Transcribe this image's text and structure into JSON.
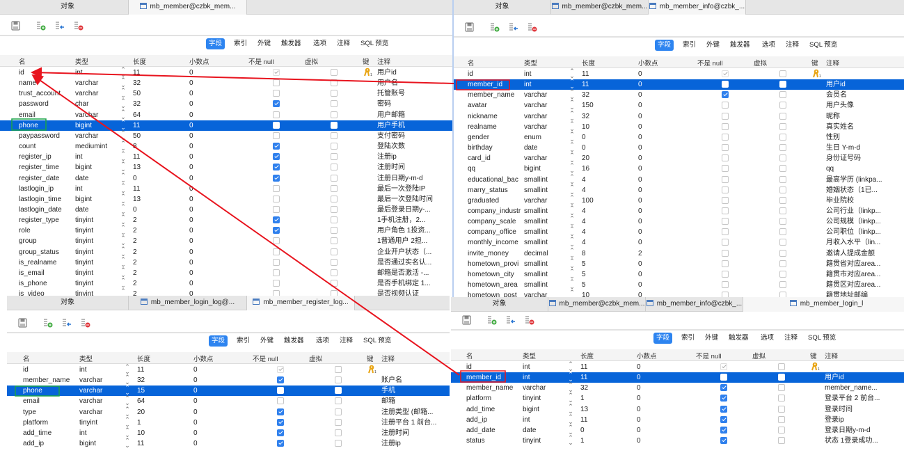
{
  "subtabs": [
    "字段",
    "索引",
    "外键",
    "触发器",
    "选项",
    "注释",
    "SQL 预览"
  ],
  "headers": [
    "名",
    "类型",
    "长度",
    "小数点",
    "不是 null",
    "虚拟",
    "键",
    "注释"
  ],
  "colors": {
    "selection": "#0764d9",
    "accent": "#2d84f0",
    "arrow": "#e8141e",
    "green_box": "#1aa34a",
    "red_box": "#e8141e"
  },
  "panels": [
    {
      "id": "member",
      "tabs": [
        {
          "label": "对象"
        },
        {
          "label": "mb_member@czbk_mem...",
          "active": true
        }
      ],
      "rows": [
        [
          "id",
          "int",
          "11",
          "0",
          "pk",
          false,
          true,
          "用户id"
        ],
        [
          "name",
          "varchar",
          "32",
          "0",
          false,
          false,
          false,
          "用户名"
        ],
        [
          "trust_account",
          "varchar",
          "50",
          "0",
          false,
          false,
          false,
          "托管账号"
        ],
        [
          "password",
          "char",
          "32",
          "0",
          true,
          false,
          false,
          "密码"
        ],
        [
          "email",
          "varchar",
          "64",
          "0",
          false,
          false,
          false,
          "用户邮箱"
        ],
        [
          "phone",
          "bigint",
          "11",
          "0",
          false,
          false,
          false,
          "用户手机"
        ],
        [
          "paypassword",
          "varchar",
          "50",
          "0",
          false,
          false,
          false,
          "支付密码"
        ],
        [
          "count",
          "mediumint",
          "8",
          "0",
          true,
          false,
          false,
          "登陆次数"
        ],
        [
          "register_ip",
          "int",
          "11",
          "0",
          true,
          false,
          false,
          "注册ip"
        ],
        [
          "register_time",
          "bigint",
          "13",
          "0",
          true,
          false,
          false,
          "注册时间"
        ],
        [
          "register_date",
          "date",
          "0",
          "0",
          true,
          false,
          false,
          "注册日期y-m-d"
        ],
        [
          "lastlogin_ip",
          "int",
          "11",
          "0",
          false,
          false,
          false,
          "最后一次登陆IP"
        ],
        [
          "lastlogin_time",
          "bigint",
          "13",
          "0",
          false,
          false,
          false,
          "最后一次登陆时间"
        ],
        [
          "lastlogin_date",
          "date",
          "0",
          "0",
          false,
          false,
          false,
          "最后登录日期y-..."
        ],
        [
          "register_type",
          "tinyint",
          "2",
          "0",
          true,
          false,
          false,
          "1手机注册，2..."
        ],
        [
          "role",
          "tinyint",
          "2",
          "0",
          true,
          false,
          false,
          "用户角色 1投资..."
        ],
        [
          "group",
          "tinyint",
          "2",
          "0",
          false,
          false,
          false,
          "1普通用户 2担..."
        ],
        [
          "group_status",
          "tinyint",
          "2",
          "0",
          false,
          false,
          false,
          "企业开户状态（..."
        ],
        [
          "is_realname",
          "tinyint",
          "2",
          "0",
          false,
          false,
          false,
          "是否通过实名认..."
        ],
        [
          "is_email",
          "tinyint",
          "2",
          "0",
          false,
          false,
          false,
          "邮箱是否激活 -..."
        ],
        [
          "is_phone",
          "tinyint",
          "2",
          "0",
          false,
          false,
          false,
          "是否手机绑定 1..."
        ],
        [
          "is_video",
          "tinyint",
          "2",
          "0",
          false,
          false,
          false,
          "是否视频认证"
        ]
      ],
      "selected_row": 5
    },
    {
      "id": "member_info",
      "tabs": [
        {
          "label": "对象"
        },
        {
          "label": "mb_member@czbk_mem..."
        },
        {
          "label": "mb_member_info@czbk_...",
          "active": true
        }
      ],
      "rows": [
        [
          "id",
          "int",
          "11",
          "0",
          "pk",
          false,
          true,
          ""
        ],
        [
          "member_id",
          "int",
          "11",
          "0",
          true,
          false,
          false,
          "用户id"
        ],
        [
          "member_name",
          "varchar",
          "32",
          "0",
          true,
          false,
          false,
          "会员名"
        ],
        [
          "avatar",
          "varchar",
          "150",
          "0",
          false,
          false,
          false,
          "用户头像"
        ],
        [
          "nickname",
          "varchar",
          "32",
          "0",
          false,
          false,
          false,
          "昵称"
        ],
        [
          "realname",
          "varchar",
          "10",
          "0",
          false,
          false,
          false,
          "真实姓名"
        ],
        [
          "gender",
          "enum",
          "0",
          "0",
          false,
          false,
          false,
          "性别"
        ],
        [
          "birthday",
          "date",
          "0",
          "0",
          false,
          false,
          false,
          "生日 Y-m-d"
        ],
        [
          "card_id",
          "varchar",
          "20",
          "0",
          false,
          false,
          false,
          "身份证号码"
        ],
        [
          "qq",
          "bigint",
          "16",
          "0",
          false,
          false,
          false,
          "qq"
        ],
        [
          "educational_bac",
          "smallint",
          "4",
          "0",
          false,
          false,
          false,
          "最高学历 (linkpa..."
        ],
        [
          "marry_status",
          "smallint",
          "4",
          "0",
          false,
          false,
          false,
          "婚姻状态（1已..."
        ],
        [
          "graduated",
          "varchar",
          "100",
          "0",
          false,
          false,
          false,
          "毕业院校"
        ],
        [
          "company_industr",
          "smallint",
          "4",
          "0",
          false,
          false,
          false,
          "公司行业（linkp..."
        ],
        [
          "company_scale",
          "smallint",
          "4",
          "0",
          false,
          false,
          false,
          "公司规模（linkp..."
        ],
        [
          "company_office",
          "smallint",
          "4",
          "0",
          false,
          false,
          false,
          "公司职位（linkp..."
        ],
        [
          "monthly_income",
          "smallint",
          "4",
          "0",
          false,
          false,
          false,
          "月收入水平（lin..."
        ],
        [
          "invite_money",
          "decimal",
          "8",
          "2",
          false,
          false,
          false,
          "邀请人提成金额"
        ],
        [
          "hometown_provi",
          "smallint",
          "5",
          "0",
          false,
          false,
          false,
          "籍贯省对应area..."
        ],
        [
          "hometown_city",
          "smallint",
          "5",
          "0",
          false,
          false,
          false,
          "籍贯市对应area..."
        ],
        [
          "hometown_area",
          "smallint",
          "5",
          "0",
          false,
          false,
          false,
          "籍贯区对应area..."
        ],
        [
          "hometown_post",
          "varchar",
          "10",
          "0",
          false,
          false,
          false,
          "籍贯地址邮编"
        ]
      ],
      "selected_row": 1
    },
    {
      "id": "register_log",
      "tabs": [
        {
          "label": "对象"
        },
        {
          "label": "mb_member_login_log@..."
        },
        {
          "label": "mb_member_register_log...",
          "active": true
        }
      ],
      "rows": [
        [
          "id",
          "int",
          "11",
          "0",
          "pk",
          false,
          true,
          ""
        ],
        [
          "member_name",
          "varchar",
          "32",
          "0",
          true,
          false,
          false,
          "账户名"
        ],
        [
          "phone",
          "varchar",
          "15",
          "0",
          false,
          false,
          false,
          "手机"
        ],
        [
          "email",
          "varchar",
          "64",
          "0",
          false,
          false,
          false,
          "邮箱"
        ],
        [
          "type",
          "varchar",
          "20",
          "0",
          true,
          false,
          false,
          "注册类型 (邮箱..."
        ],
        [
          "platform",
          "tinyint",
          "1",
          "0",
          true,
          false,
          false,
          "注册平台 1 前台..."
        ],
        [
          "add_time",
          "int",
          "10",
          "0",
          true,
          false,
          false,
          "注册时间"
        ],
        [
          "add_ip",
          "bigint",
          "11",
          "0",
          true,
          false,
          false,
          "注册ip"
        ]
      ],
      "selected_row": 2
    },
    {
      "id": "login_log",
      "tabs": [
        {
          "label": "对象"
        },
        {
          "label": "mb_member@czbk_mem..."
        },
        {
          "label": "mb_member_info@czbk_..."
        },
        {
          "label": "mb_member_login_l",
          "active": true
        }
      ],
      "rows": [
        [
          "id",
          "int",
          "11",
          "0",
          "pk",
          false,
          true,
          ""
        ],
        [
          "member_id",
          "int",
          "11",
          "0",
          false,
          false,
          false,
          "用户id"
        ],
        [
          "member_name",
          "varchar",
          "32",
          "0",
          true,
          false,
          false,
          "member_name..."
        ],
        [
          "platform",
          "tinyint",
          "1",
          "0",
          true,
          false,
          false,
          "登录平台 2 前台..."
        ],
        [
          "add_time",
          "bigint",
          "13",
          "0",
          true,
          false,
          false,
          "登录时间"
        ],
        [
          "add_ip",
          "int",
          "11",
          "0",
          true,
          false,
          false,
          "登录ip"
        ],
        [
          "add_date",
          "date",
          "0",
          "0",
          true,
          false,
          false,
          "登录日期y-m-d"
        ],
        [
          "status",
          "tinyint",
          "1",
          "0",
          true,
          false,
          false,
          "状态 1登录成功..."
        ]
      ],
      "selected_row": 1
    }
  ]
}
